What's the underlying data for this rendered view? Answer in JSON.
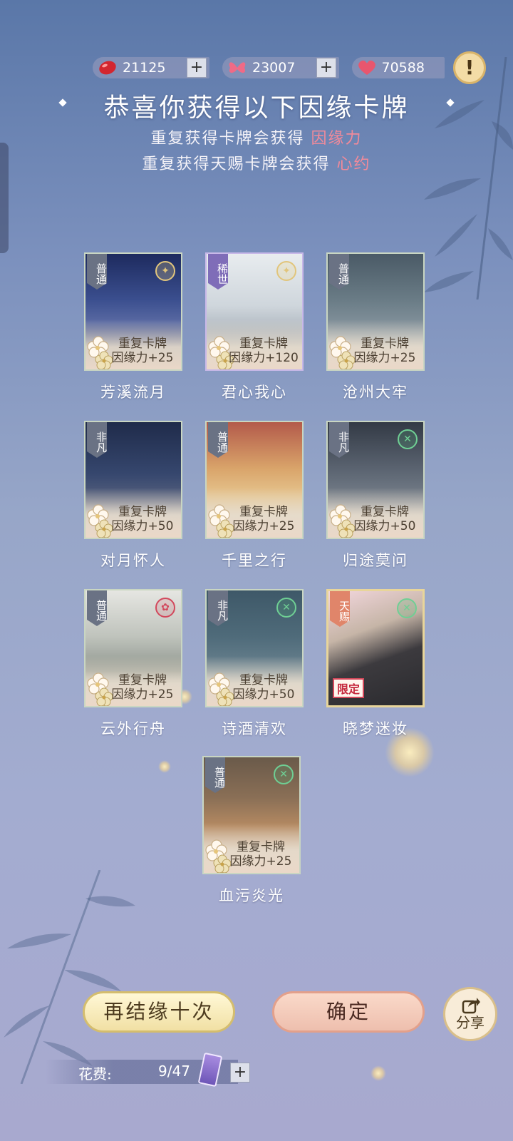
{
  "currencies": [
    {
      "icon": "red-bean-icon",
      "value": "21125"
    },
    {
      "icon": "butterfly-icon",
      "value": "23007"
    },
    {
      "icon": "pink-heart-icon",
      "value": "70588"
    }
  ],
  "header": {
    "title": "恭喜你获得以下因缘卡牌",
    "line1_text": "重复获得卡牌会获得",
    "line1_highlight": "因缘力",
    "line2_text": "重复获得天赐卡牌会获得",
    "line2_highlight": "心约"
  },
  "cards": [
    {
      "rarity": "普通",
      "dup_title": "重复卡牌",
      "dup_reward": "因缘力+25",
      "name": "芳溪流月"
    },
    {
      "rarity": "稀世",
      "dup_title": "重复卡牌",
      "dup_reward": "因缘力+120",
      "name": "君心我心"
    },
    {
      "rarity": "普通",
      "dup_title": "重复卡牌",
      "dup_reward": "因缘力+25",
      "name": "沧州大牢"
    },
    {
      "rarity": "非凡",
      "dup_title": "重复卡牌",
      "dup_reward": "因缘力+50",
      "name": "对月怀人"
    },
    {
      "rarity": "普通",
      "dup_title": "重复卡牌",
      "dup_reward": "因缘力+25",
      "name": "千里之行"
    },
    {
      "rarity": "非凡",
      "dup_title": "重复卡牌",
      "dup_reward": "因缘力+50",
      "name": "归途莫问"
    },
    {
      "rarity": "普通",
      "dup_title": "重复卡牌",
      "dup_reward": "因缘力+25",
      "name": "云外行舟"
    },
    {
      "rarity": "非凡",
      "dup_title": "重复卡牌",
      "dup_reward": "因缘力+50",
      "name": "诗酒清欢"
    },
    {
      "rarity": "天赐",
      "badge": "限定",
      "name": "晓梦迷妆"
    },
    {
      "rarity": "普通",
      "dup_title": "重复卡牌",
      "dup_reward": "因缘力+25",
      "name": "血污炎光"
    }
  ],
  "buttons": {
    "again": "再结缘十次",
    "confirm": "确定",
    "share": "分享",
    "plus": "+",
    "warn": "!"
  },
  "cost": {
    "label": "花费:",
    "value": "9/47"
  },
  "colors": {
    "highlight": "#f28a9a",
    "rare_tag": "#7f6db8",
    "heaven_tag": "#e0856a",
    "normal_tag": "#6a7284"
  }
}
